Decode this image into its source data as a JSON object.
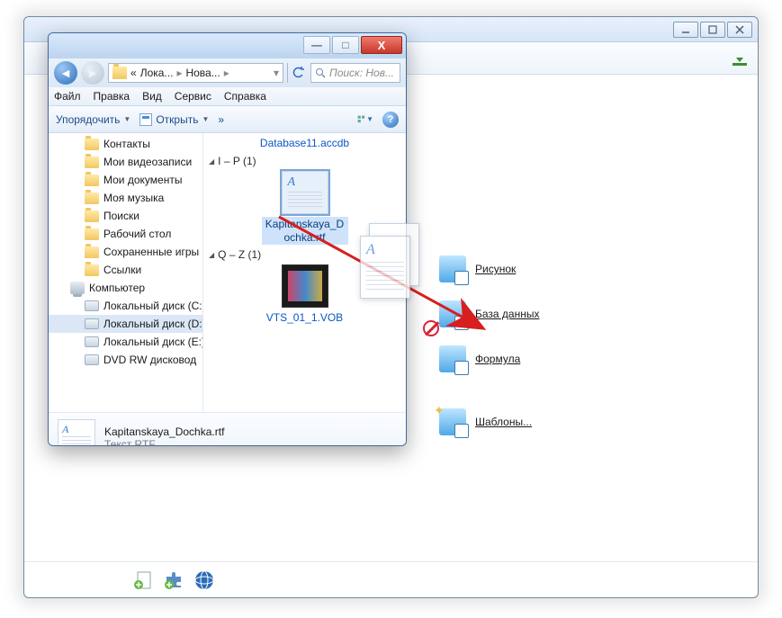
{
  "outer": {
    "launch_items": [
      {
        "label": "Рисунок"
      },
      {
        "label": "База данных"
      },
      {
        "label": "Формула"
      },
      {
        "label": "Шаблоны..."
      }
    ]
  },
  "explorer": {
    "titlebar": {
      "min": "—",
      "max": "□",
      "close": "X"
    },
    "nav": {
      "breadcrumb_prefix": "«",
      "breadcrumb_1": "Лока...",
      "breadcrumb_2": "Нова...",
      "search_placeholder": "Поиск: Нов..."
    },
    "menu": {
      "file": "Файл",
      "edit": "Правка",
      "view": "Вид",
      "service": "Сервис",
      "help": "Справка"
    },
    "toolbar": {
      "organize": "Упорядочить",
      "open": "Открыть",
      "help": "?"
    },
    "tree": [
      {
        "label": "Контакты",
        "icon": "folder",
        "level": 1
      },
      {
        "label": "Мои видеозаписи",
        "icon": "folder",
        "level": 1
      },
      {
        "label": "Мои документы",
        "icon": "folder",
        "level": 1
      },
      {
        "label": "Моя музыка",
        "icon": "folder",
        "level": 1
      },
      {
        "label": "Поиски",
        "icon": "folder",
        "level": 1
      },
      {
        "label": "Рабочий стол",
        "icon": "folder",
        "level": 1
      },
      {
        "label": "Сохраненные игры",
        "icon": "folder",
        "level": 1
      },
      {
        "label": "Ссылки",
        "icon": "folder",
        "level": 1
      },
      {
        "label": "Компьютер",
        "icon": "computer",
        "level": 0
      },
      {
        "label": "Локальный диск (C:)",
        "icon": "disk",
        "level": 1
      },
      {
        "label": "Локальный диск (D:)",
        "icon": "disk",
        "level": 1,
        "selected": true
      },
      {
        "label": "Локальный диск (E:)",
        "icon": "disk",
        "level": 1
      },
      {
        "label": "DVD RW дисковод",
        "icon": "disk",
        "level": 1
      }
    ],
    "content": {
      "db_label": "Database11.accdb",
      "group1": "I – P (1)",
      "file1": "Kapitanskaya_Dochka.rtf",
      "group2": "Q – Z (1)",
      "file2": "VTS_01_1.VOB"
    },
    "details": {
      "name": "Kapitanskaya_Dochka.rtf",
      "type": "Текст RTF"
    }
  }
}
